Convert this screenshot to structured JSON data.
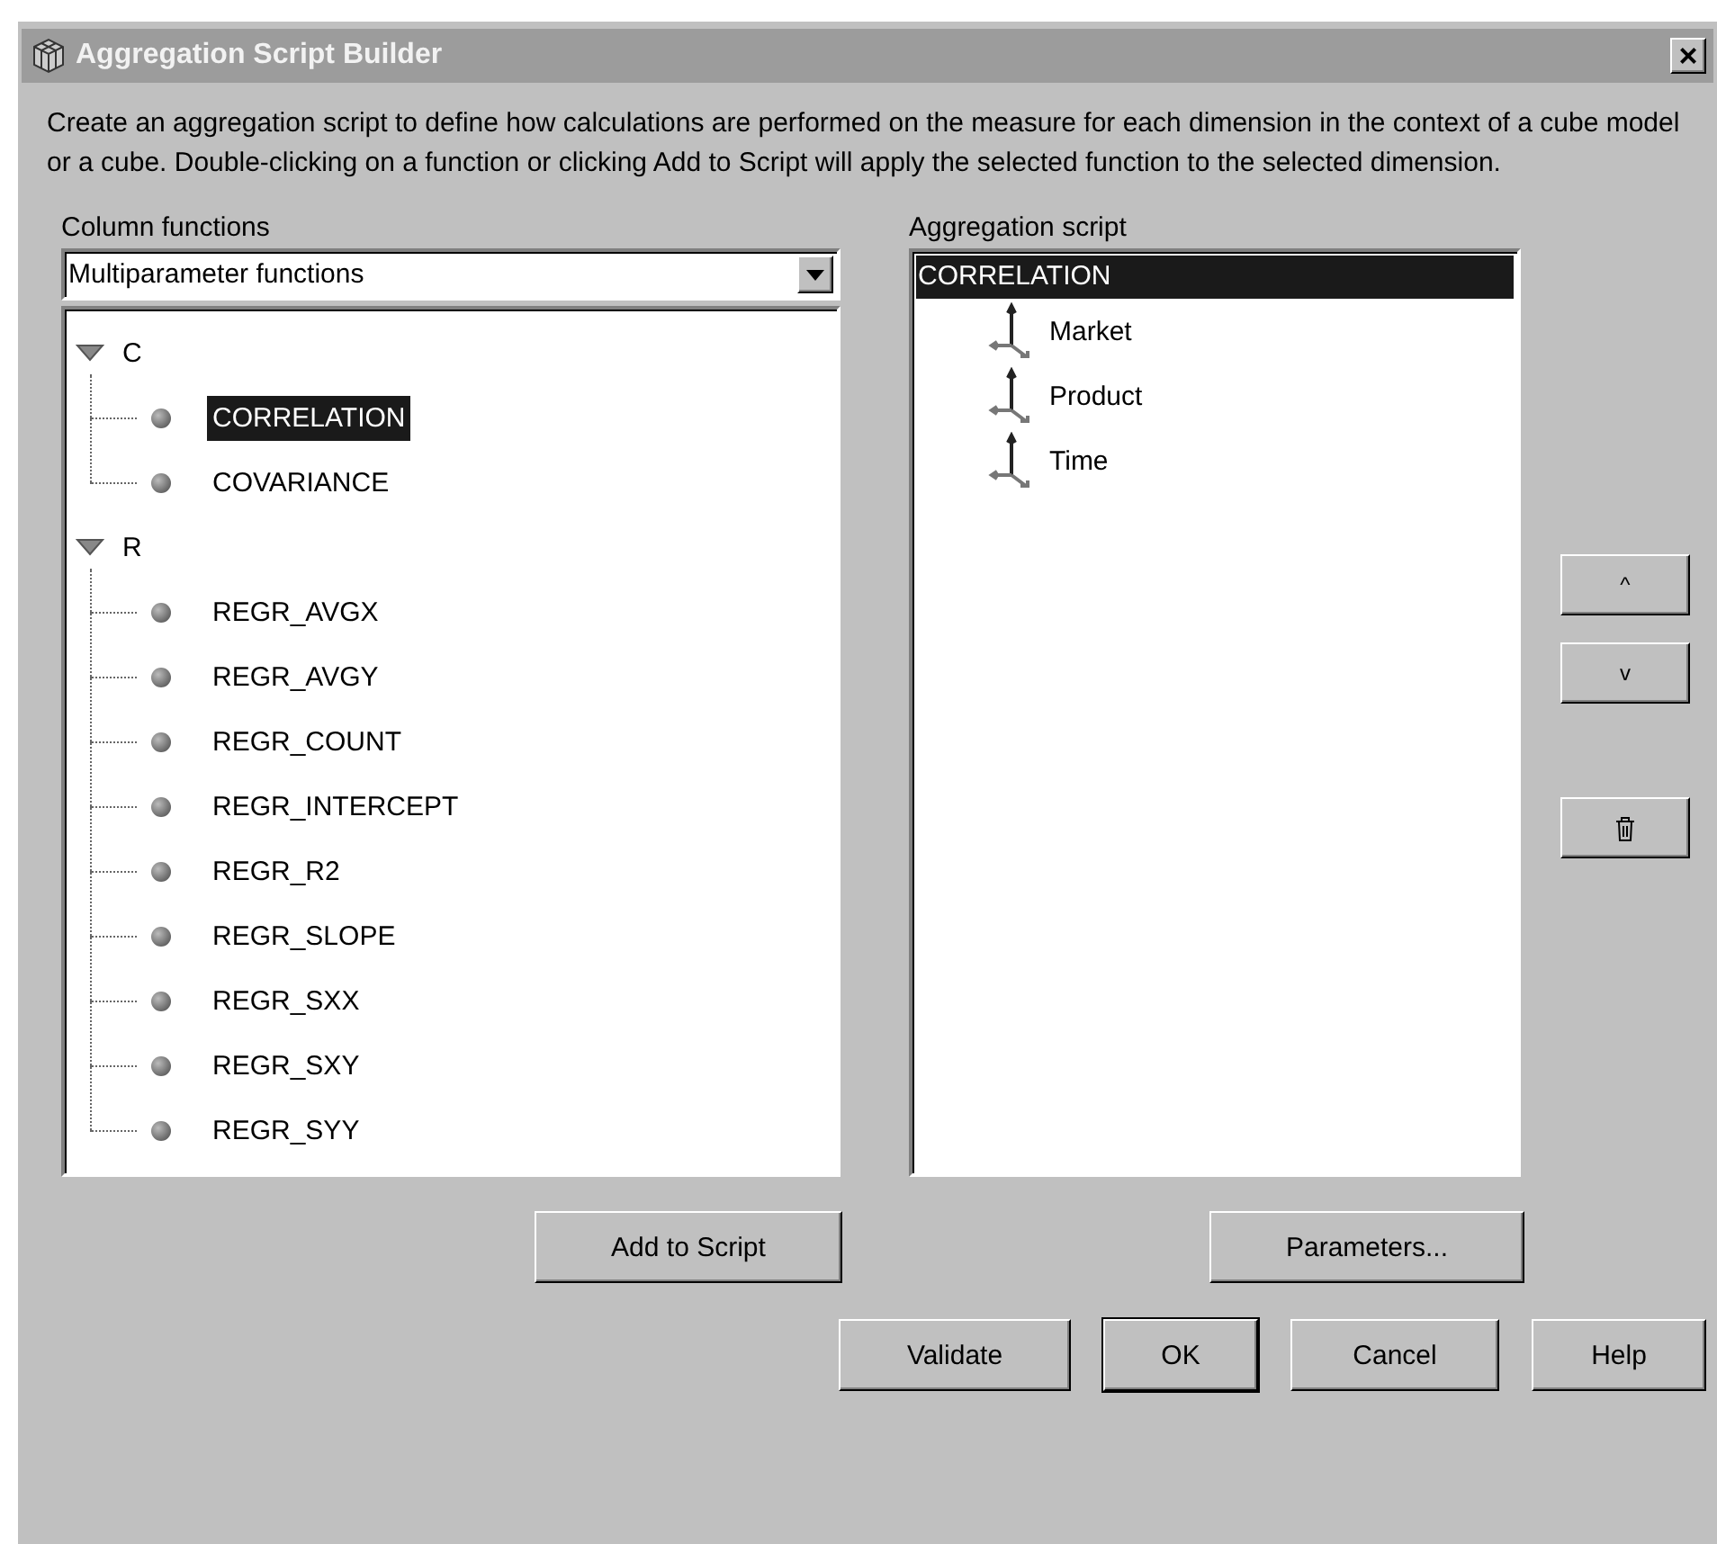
{
  "window": {
    "title": "Aggregation Script Builder",
    "close": "×"
  },
  "description": "Create an aggregation script to define how calculations are performed on the measure for each dimension in the context of a cube model or a cube. Double-clicking on a function or clicking Add to Script will apply the selected function to the selected dimension.",
  "column_functions": {
    "label": "Column functions",
    "dropdown": {
      "value": "Multiparameter functions"
    },
    "tree": [
      {
        "label": "C",
        "expanded": true,
        "children": [
          {
            "label": "CORRELATION",
            "selected": true
          },
          {
            "label": "COVARIANCE",
            "selected": false
          }
        ]
      },
      {
        "label": "R",
        "expanded": true,
        "children": [
          {
            "label": "REGR_AVGX",
            "selected": false
          },
          {
            "label": "REGR_AVGY",
            "selected": false
          },
          {
            "label": "REGR_COUNT",
            "selected": false
          },
          {
            "label": "REGR_INTERCEPT",
            "selected": false
          },
          {
            "label": "REGR_R2",
            "selected": false
          },
          {
            "label": "REGR_SLOPE",
            "selected": false
          },
          {
            "label": "REGR_SXX",
            "selected": false
          },
          {
            "label": "REGR_SXY",
            "selected": false
          },
          {
            "label": "REGR_SYY",
            "selected": false
          }
        ]
      }
    ]
  },
  "aggregation_script": {
    "label": "Aggregation script",
    "items": [
      {
        "label": "CORRELATION",
        "selected": true,
        "children": [
          {
            "label": "Market",
            "selected": false
          },
          {
            "label": "Product",
            "selected": false
          },
          {
            "label": "Time",
            "selected": false
          }
        ]
      }
    ]
  },
  "side_buttons": [
    {
      "kind": "text",
      "label": "^"
    },
    {
      "kind": "text",
      "label": "v"
    },
    {
      "kind": "delete"
    }
  ],
  "add_button": "Add to Script",
  "parameters_button": "Parameters...",
  "buttons": [
    {
      "label": "Validate",
      "default": false
    },
    {
      "label": "OK",
      "default": true
    },
    {
      "label": "Cancel",
      "default": false
    },
    {
      "label": "Help",
      "default": false
    }
  ]
}
